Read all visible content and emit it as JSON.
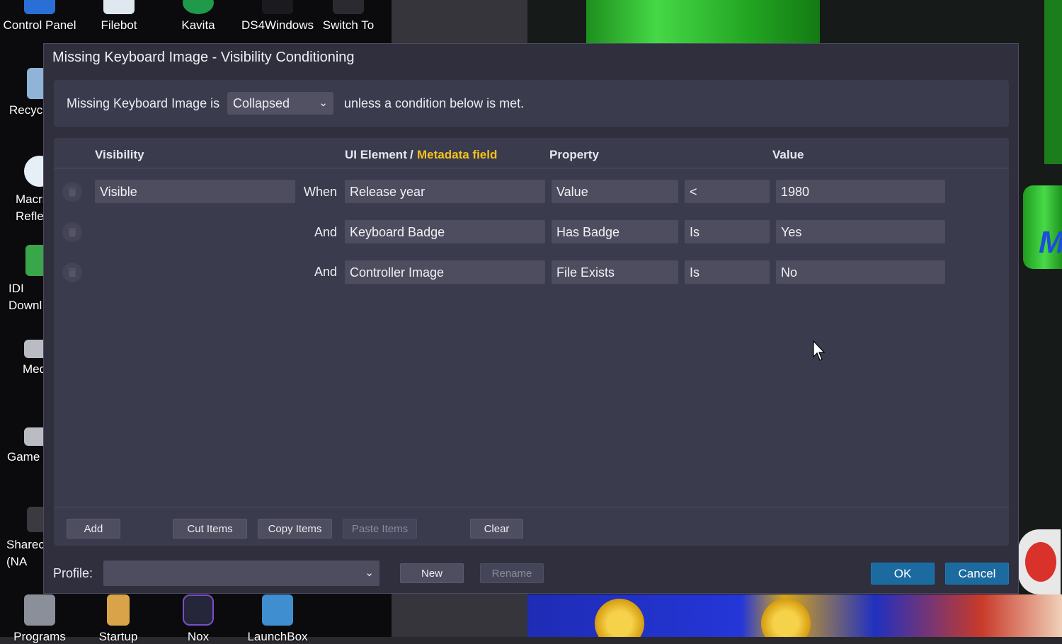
{
  "desktop": {
    "top_icons": [
      {
        "label": "Control Panel",
        "icon": "control-panel-icon"
      },
      {
        "label": "Filebot",
        "icon": "filebot-icon"
      },
      {
        "label": "Kavita",
        "icon": "kavita-icon"
      },
      {
        "label": "DS4Windows",
        "icon": "gamepad-icon"
      },
      {
        "label": "Switch To",
        "icon": "switch-icon"
      }
    ],
    "left_icons": [
      {
        "label": "Recycl",
        "icon": "recycle-bin-icon"
      },
      {
        "label": "Macri\nRefle",
        "icon": "macrium-icon"
      },
      {
        "label": "IDI\nDownl",
        "icon": "idm-icon"
      },
      {
        "label": "Med",
        "icon": "drive-icon"
      },
      {
        "label": "Game",
        "icon": "drive-icon"
      },
      {
        "label": "Sharec\n(NA",
        "icon": "network-drive-icon"
      }
    ],
    "bottom_icons": [
      {
        "label": "Programs",
        "icon": "programs-icon"
      },
      {
        "label": "Startup",
        "icon": "startup-icon"
      },
      {
        "label": "Nox",
        "icon": "nox-icon"
      },
      {
        "label": "LaunchBox",
        "icon": "launchbox-icon"
      }
    ]
  },
  "dialog": {
    "title": "Missing Keyboard Image - Visibility Conditioning",
    "condition_bar": {
      "prefix": "Missing Keyboard Image is",
      "selected_state": "Collapsed",
      "suffix": "unless a condition below is met."
    },
    "headers": {
      "visibility": "Visibility",
      "ui_element": "UI Element",
      "separator": "/",
      "metadata_field": "Metadata field",
      "property": "Property",
      "value": "Value"
    },
    "rows": [
      {
        "visibility": "Visible",
        "conjunction": "When",
        "element": "Release year",
        "property": "Value",
        "operator": "<",
        "value": "1980"
      },
      {
        "visibility": "",
        "conjunction": "And",
        "element": "Keyboard Badge",
        "property": "Has Badge",
        "operator": "Is",
        "value": "Yes"
      },
      {
        "visibility": "",
        "conjunction": "And",
        "element": "Controller Image",
        "property": "File Exists",
        "operator": "Is",
        "value": "No"
      }
    ],
    "buttons": {
      "add": "Add",
      "cut": "Cut Items",
      "copy": "Copy Items",
      "paste": "Paste Items",
      "clear": "Clear"
    },
    "footer": {
      "profile_label": "Profile:",
      "profile_value": "",
      "new": "New",
      "rename": "Rename",
      "ok": "OK",
      "cancel": "Cancel"
    }
  },
  "colors": {
    "accent_yellow": "#f3c21b",
    "primary_button": "#1b6aa0",
    "dialog_bg": "#2f2f3e",
    "panel_bg": "#3b3b4e"
  }
}
